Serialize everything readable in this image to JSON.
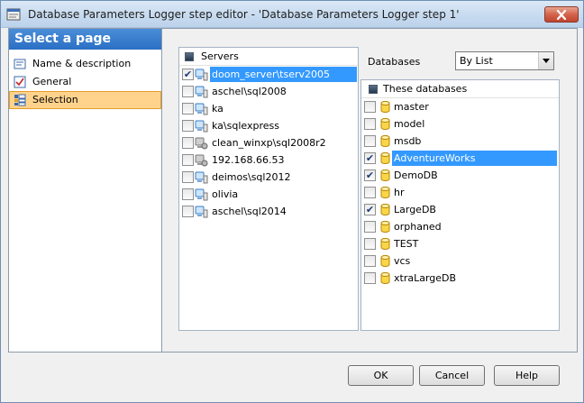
{
  "window": {
    "title": "Database Parameters Logger step editor - 'Database Parameters Logger step 1'"
  },
  "nav": {
    "header": "Select a page",
    "items": [
      {
        "label": "Name & description",
        "icon": "name-description-icon"
      },
      {
        "label": "General",
        "icon": "general-icon"
      },
      {
        "label": "Selection",
        "icon": "selection-icon",
        "selected": true
      }
    ]
  },
  "servers": {
    "header": "Servers",
    "items": [
      {
        "label": "doom_server\\tserv2005",
        "checked": true,
        "selected": true,
        "icon": "server-icon"
      },
      {
        "label": "aschel\\sql2008",
        "checked": false,
        "icon": "server-icon"
      },
      {
        "label": "ka",
        "checked": false,
        "icon": "server-icon"
      },
      {
        "label": "ka\\sqlexpress",
        "checked": false,
        "icon": "server-icon"
      },
      {
        "label": "clean_winxp\\sql2008r2",
        "checked": false,
        "icon": "server-offline-icon"
      },
      {
        "label": "192.168.66.53",
        "checked": false,
        "icon": "server-offline-icon"
      },
      {
        "label": "deimos\\sql2012",
        "checked": false,
        "icon": "server-icon"
      },
      {
        "label": "olivia",
        "checked": false,
        "icon": "server-icon"
      },
      {
        "label": "aschel\\sql2014",
        "checked": false,
        "icon": "server-icon"
      }
    ]
  },
  "databases": {
    "label": "Databases",
    "mode_value": "By List",
    "header": "These databases",
    "items": [
      {
        "label": "master",
        "checked": false
      },
      {
        "label": "model",
        "checked": false
      },
      {
        "label": "msdb",
        "checked": false
      },
      {
        "label": "AdventureWorks",
        "checked": true,
        "selected": true
      },
      {
        "label": "DemoDB",
        "checked": true
      },
      {
        "label": "hr",
        "checked": false
      },
      {
        "label": "LargeDB",
        "checked": true
      },
      {
        "label": "orphaned",
        "checked": false
      },
      {
        "label": "TEST",
        "checked": false
      },
      {
        "label": "vcs",
        "checked": false
      },
      {
        "label": "xtraLargeDB",
        "checked": false
      }
    ]
  },
  "buttons": {
    "ok": "OK",
    "cancel": "Cancel",
    "help": "Help"
  },
  "colors": {
    "nav_header": "#2a6fc4",
    "selection": "#3399ff",
    "nav_selected": "#ffd38c"
  }
}
